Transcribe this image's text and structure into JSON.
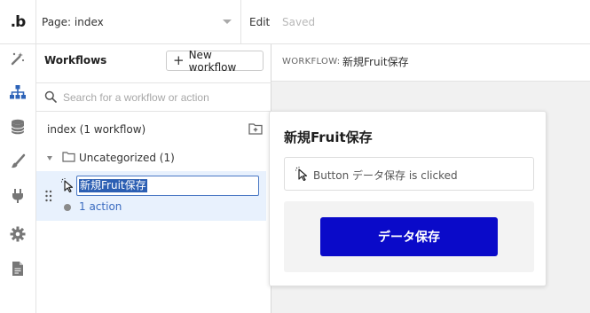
{
  "app": {
    "logo": ".b"
  },
  "topbar": {
    "page_select": "Page: index",
    "edit": "Edit",
    "status": "Saved"
  },
  "rail": {
    "icons": [
      "design-icon",
      "workflow-icon",
      "data-icon",
      "styles-icon",
      "plugins-icon",
      "settings-icon",
      "logs-icon"
    ],
    "active": "workflow-icon"
  },
  "workflows": {
    "title": "Workflows",
    "new_button": "New workflow",
    "search_placeholder": "Search for a workflow or action",
    "page_group": "index (1 workflow)",
    "folder": "Uncategorized (1)",
    "item": {
      "name": "新規Fruit保存",
      "actions": "1 action"
    }
  },
  "canvas": {
    "prefix": "WORKFLOW:",
    "workflow_name": "新規Fruit保存",
    "card": {
      "title": "新規Fruit保存",
      "event": "Button データ保存 is clicked",
      "action_button": "データ保存"
    }
  },
  "colors": {
    "accent": "#0a0ac9",
    "selection_bg": "#e8f1fd",
    "link": "#3a6bc0"
  }
}
